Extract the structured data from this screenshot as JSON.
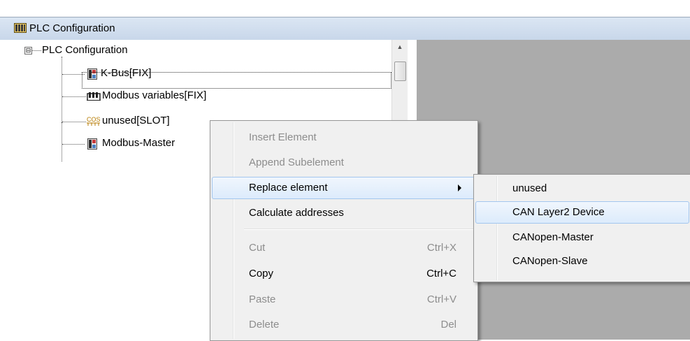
{
  "window": {
    "title": "PLC Configuration",
    "colors": {
      "titlebar": "#c8d7ea",
      "right_pane": "#ababab",
      "menu_bg": "#f0f0f0",
      "highlight_border": "#a3c6ee",
      "disabled_text": "#8d8d8d"
    }
  },
  "tree": {
    "root": {
      "label": "PLC Configuration",
      "expander": "⊟"
    },
    "children": [
      {
        "label": "K-Bus[FIX]",
        "icon": "module-icon"
      },
      {
        "label": "Modbus variables[FIX]",
        "icon": "variables-icon"
      },
      {
        "label": "unused[SLOT]",
        "icon": "cos-icon",
        "icon_text": "COS"
      },
      {
        "label": "Modbus-Master",
        "icon": "module-icon"
      }
    ]
  },
  "context_menu": {
    "items": [
      {
        "label": "Insert Element",
        "shortcut": "",
        "enabled": false
      },
      {
        "label": "Append Subelement",
        "shortcut": "",
        "enabled": false
      },
      {
        "label": "Replace element",
        "shortcut": "",
        "enabled": true,
        "highlighted": true,
        "submenu": true
      },
      {
        "label": "Calculate addresses",
        "shortcut": "",
        "enabled": true
      },
      {
        "label": "Cut",
        "shortcut": "Ctrl+X",
        "enabled": false
      },
      {
        "label": "Copy",
        "shortcut": "Ctrl+C",
        "enabled": true
      },
      {
        "label": "Paste",
        "shortcut": "Ctrl+V",
        "enabled": false
      },
      {
        "label": "Delete",
        "shortcut": "Del",
        "enabled": false
      }
    ]
  },
  "submenu": {
    "items": [
      {
        "label": "unused",
        "highlighted": false
      },
      {
        "label": "CAN Layer2 Device",
        "highlighted": true
      },
      {
        "label": "CANopen-Master",
        "highlighted": false
      },
      {
        "label": "CANopen-Slave",
        "highlighted": false
      }
    ]
  }
}
